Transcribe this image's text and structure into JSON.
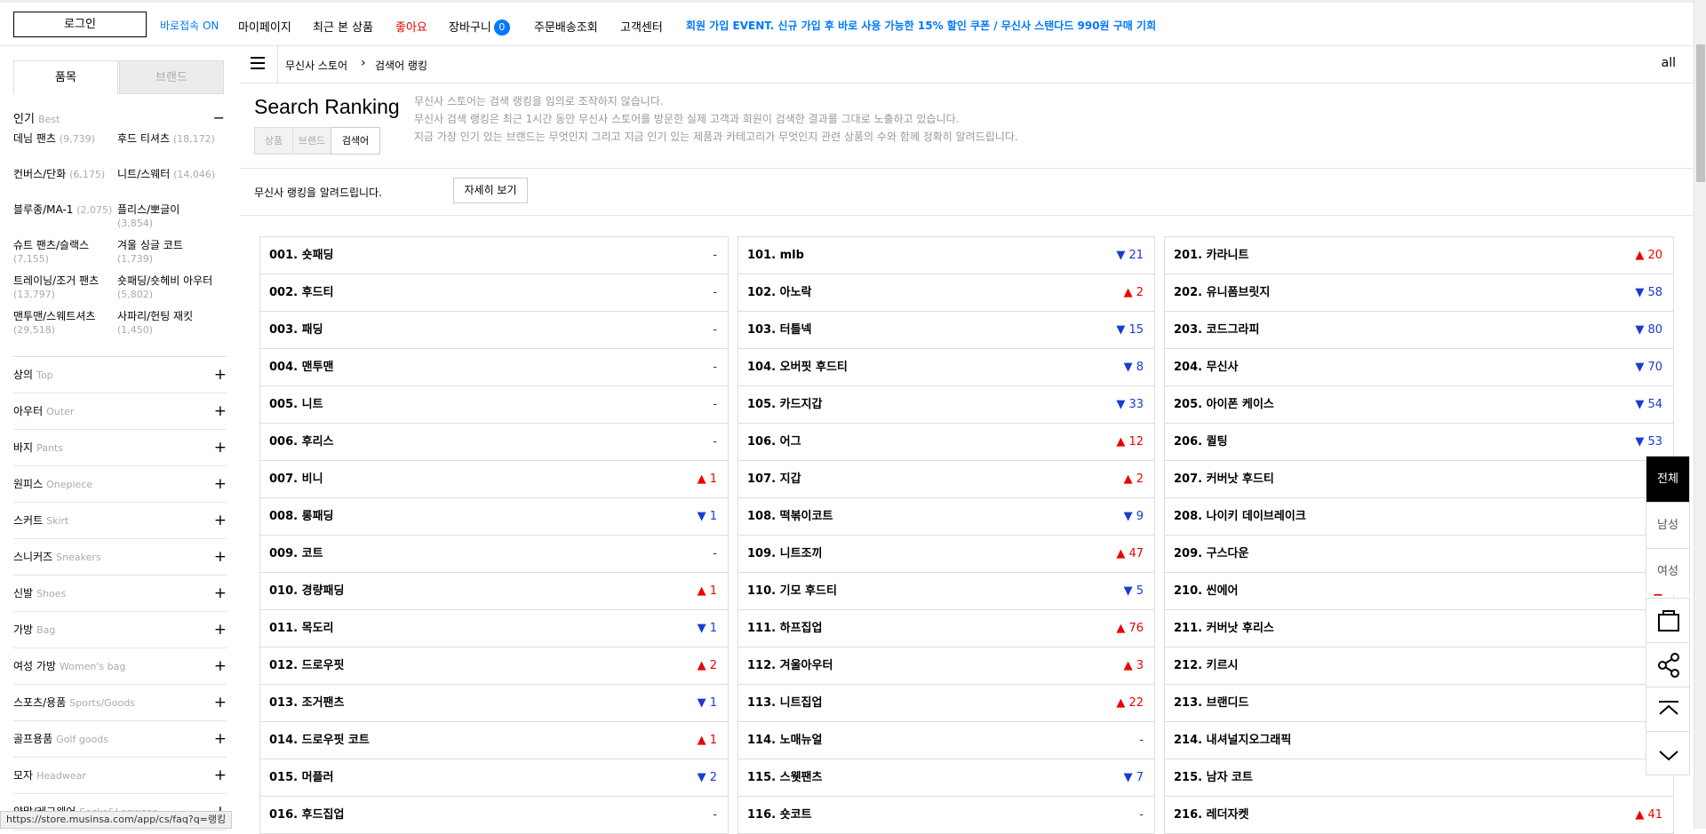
{
  "topbar": {
    "login": "로그인",
    "quick": "바로접속 ON",
    "links": [
      "마이페이지",
      "최근 본 상품",
      "좋아요",
      "장바구니",
      "주문배송조회",
      "고객센터"
    ],
    "cart_count": "0",
    "event": "회원 가입 EVENT. 신규 가입 후 바로 사용 가능한 15% 할인 쿠폰 / 무신사 스탠다드 990원 구매 기회",
    "colors": {
      "quick": "#0078ff",
      "like": "#e00000",
      "event": "#0078ff"
    }
  },
  "sidebar": {
    "tabs": [
      "품목",
      "브랜드"
    ],
    "popular": {
      "title": "인기",
      "en": "Best",
      "items": [
        {
          "name": "데님 팬츠",
          "count": "(9,739)"
        },
        {
          "name": "후드 티셔츠",
          "count": "(18,172)"
        },
        {
          "name": "컨버스/단화",
          "count": "(6,175)"
        },
        {
          "name": "니트/스웨터",
          "count": "(14,046)"
        },
        {
          "name": "블루종/MA-1",
          "count": "(2,075)"
        },
        {
          "name": "플리스/뽀글이",
          "count": "(3,854)"
        },
        {
          "name": "슈트 팬츠/슬랙스",
          "count": "(7,155)"
        },
        {
          "name": "겨울 싱글 코트",
          "count": "(1,739)"
        },
        {
          "name": "트레이닝/조거 팬츠",
          "count": "(13,797)"
        },
        {
          "name": "숏패딩/숏헤비 아우터",
          "count": "(5,802)"
        },
        {
          "name": "맨투맨/스웨트셔츠",
          "count": "(29,518)"
        },
        {
          "name": "사파리/헌팅 재킷",
          "count": "(1,450)"
        }
      ]
    },
    "categories": [
      {
        "ko": "상의",
        "en": "Top"
      },
      {
        "ko": "아우터",
        "en": "Outer"
      },
      {
        "ko": "바지",
        "en": "Pants"
      },
      {
        "ko": "원피스",
        "en": "Onepiece"
      },
      {
        "ko": "스커트",
        "en": "Skirt"
      },
      {
        "ko": "스니커즈",
        "en": "Sneakers"
      },
      {
        "ko": "신발",
        "en": "Shoes"
      },
      {
        "ko": "가방",
        "en": "Bag"
      },
      {
        "ko": "여성 가방",
        "en": "Women's bag"
      },
      {
        "ko": "스포츠/용품",
        "en": "Sports/Goods"
      },
      {
        "ko": "골프용품",
        "en": "Golf goods"
      },
      {
        "ko": "모자",
        "en": "Headwear"
      },
      {
        "ko": "양말/레그웨어",
        "en": "Socks&Legwear"
      }
    ]
  },
  "breadcrumb": {
    "store": "무신사 스토어",
    "current": "검색어 랭킹",
    "all": "all"
  },
  "ranking": {
    "title": "Search Ranking",
    "tabs": [
      "상품",
      "브랜드",
      "검색어"
    ],
    "desc": [
      "무신사 스토어는 검색 랭킹을 임의로 조작하지 않습니다.",
      "무신사 검색 랭킹은 최근 1시간 동안 무신사 스토어를 방문한 실제 고객과 회원이 검색한 결과를 그대로 노출하고 있습니다.",
      "지금 가장 인기 있는 브랜드는 무엇인지 그리고 지금 인기 있는 제품과 카테고리가 무엇인지 관련 상품의 수와 함께 정확히 알려드립니다."
    ],
    "info": "무신사 랭킹을 알려드립니다.",
    "more": "자세히 보기"
  },
  "columns": [
    [
      {
        "rank": "001.",
        "kw": "숏패딩",
        "dir": "",
        "n": "-"
      },
      {
        "rank": "002.",
        "kw": "후드티",
        "dir": "",
        "n": "-"
      },
      {
        "rank": "003.",
        "kw": "패딩",
        "dir": "",
        "n": "-"
      },
      {
        "rank": "004.",
        "kw": "맨투맨",
        "dir": "",
        "n": "-"
      },
      {
        "rank": "005.",
        "kw": "니트",
        "dir": "",
        "n": "-"
      },
      {
        "rank": "006.",
        "kw": "후리스",
        "dir": "",
        "n": "-"
      },
      {
        "rank": "007.",
        "kw": "비니",
        "dir": "up",
        "n": "1"
      },
      {
        "rank": "008.",
        "kw": "롱패딩",
        "dir": "down",
        "n": "1"
      },
      {
        "rank": "009.",
        "kw": "코트",
        "dir": "",
        "n": "-"
      },
      {
        "rank": "010.",
        "kw": "경량패딩",
        "dir": "up",
        "n": "1"
      },
      {
        "rank": "011.",
        "kw": "목도리",
        "dir": "down",
        "n": "1"
      },
      {
        "rank": "012.",
        "kw": "드로우핏",
        "dir": "up",
        "n": "2"
      },
      {
        "rank": "013.",
        "kw": "조거팬츠",
        "dir": "down",
        "n": "1"
      },
      {
        "rank": "014.",
        "kw": "드로우핏 코트",
        "dir": "up",
        "n": "1"
      },
      {
        "rank": "015.",
        "kw": "머플러",
        "dir": "down",
        "n": "2"
      },
      {
        "rank": "016.",
        "kw": "후드집업",
        "dir": "",
        "n": "-"
      }
    ],
    [
      {
        "rank": "101.",
        "kw": "mlb",
        "dir": "down",
        "n": "21"
      },
      {
        "rank": "102.",
        "kw": "아노락",
        "dir": "up",
        "n": "2"
      },
      {
        "rank": "103.",
        "kw": "터틀넥",
        "dir": "down",
        "n": "15"
      },
      {
        "rank": "104.",
        "kw": "오버핏 후드티",
        "dir": "down",
        "n": "8"
      },
      {
        "rank": "105.",
        "kw": "카드지갑",
        "dir": "down",
        "n": "33"
      },
      {
        "rank": "106.",
        "kw": "어그",
        "dir": "up",
        "n": "12"
      },
      {
        "rank": "107.",
        "kw": "지갑",
        "dir": "up",
        "n": "2"
      },
      {
        "rank": "108.",
        "kw": "떡볶이코트",
        "dir": "down",
        "n": "9"
      },
      {
        "rank": "109.",
        "kw": "니트조끼",
        "dir": "up",
        "n": "47"
      },
      {
        "rank": "110.",
        "kw": "기모 후드티",
        "dir": "down",
        "n": "5"
      },
      {
        "rank": "111.",
        "kw": "하프집업",
        "dir": "up",
        "n": "76"
      },
      {
        "rank": "112.",
        "kw": "겨울아우터",
        "dir": "up",
        "n": "3"
      },
      {
        "rank": "113.",
        "kw": "니트집업",
        "dir": "up",
        "n": "22"
      },
      {
        "rank": "114.",
        "kw": "노매뉴얼",
        "dir": "",
        "n": "-"
      },
      {
        "rank": "115.",
        "kw": "스웻팬츠",
        "dir": "down",
        "n": "7"
      },
      {
        "rank": "116.",
        "kw": "숏코트",
        "dir": "",
        "n": "-"
      }
    ],
    [
      {
        "rank": "201.",
        "kw": "카라니트",
        "dir": "up",
        "n": "20"
      },
      {
        "rank": "202.",
        "kw": "유니폼브릿지",
        "dir": "down",
        "n": "58"
      },
      {
        "rank": "203.",
        "kw": "코드그라피",
        "dir": "down",
        "n": "80"
      },
      {
        "rank": "204.",
        "kw": "무신사",
        "dir": "down",
        "n": "70"
      },
      {
        "rank": "205.",
        "kw": "아이폰 케이스",
        "dir": "down",
        "n": "54"
      },
      {
        "rank": "206.",
        "kw": "퀼팅",
        "dir": "down",
        "n": "53"
      },
      {
        "rank": "207.",
        "kw": "커버낫 후드티",
        "dir": "up",
        "n": ""
      },
      {
        "rank": "208.",
        "kw": "나이키 데이브레이크",
        "dir": "up",
        "n": ""
      },
      {
        "rank": "209.",
        "kw": "구스다운",
        "dir": "",
        "n": ""
      },
      {
        "rank": "210.",
        "kw": "씬에어",
        "dir": "up",
        "n": ""
      },
      {
        "rank": "211.",
        "kw": "커버낫 후리스",
        "dir": "up",
        "n": ""
      },
      {
        "rank": "212.",
        "kw": "키르시",
        "dir": "down",
        "n": ""
      },
      {
        "rank": "213.",
        "kw": "브랜디드",
        "dir": "up",
        "n": ""
      },
      {
        "rank": "214.",
        "kw": "내셔널지오그래픽",
        "dir": "",
        "n": "-"
      },
      {
        "rank": "215.",
        "kw": "남자 코트",
        "dir": "",
        "n": ""
      },
      {
        "rank": "216.",
        "kw": "레더자켓",
        "dir": "up",
        "n": "41"
      }
    ]
  ],
  "rightbar": {
    "labels": [
      "전체",
      "남성",
      "여성"
    ],
    "icons": [
      "shopping-bag-icon",
      "share-icon",
      "scroll-top-icon",
      "scroll-down-icon"
    ]
  },
  "status_url": "https://store.musinsa.com/app/cs/faq?q=랭킹"
}
